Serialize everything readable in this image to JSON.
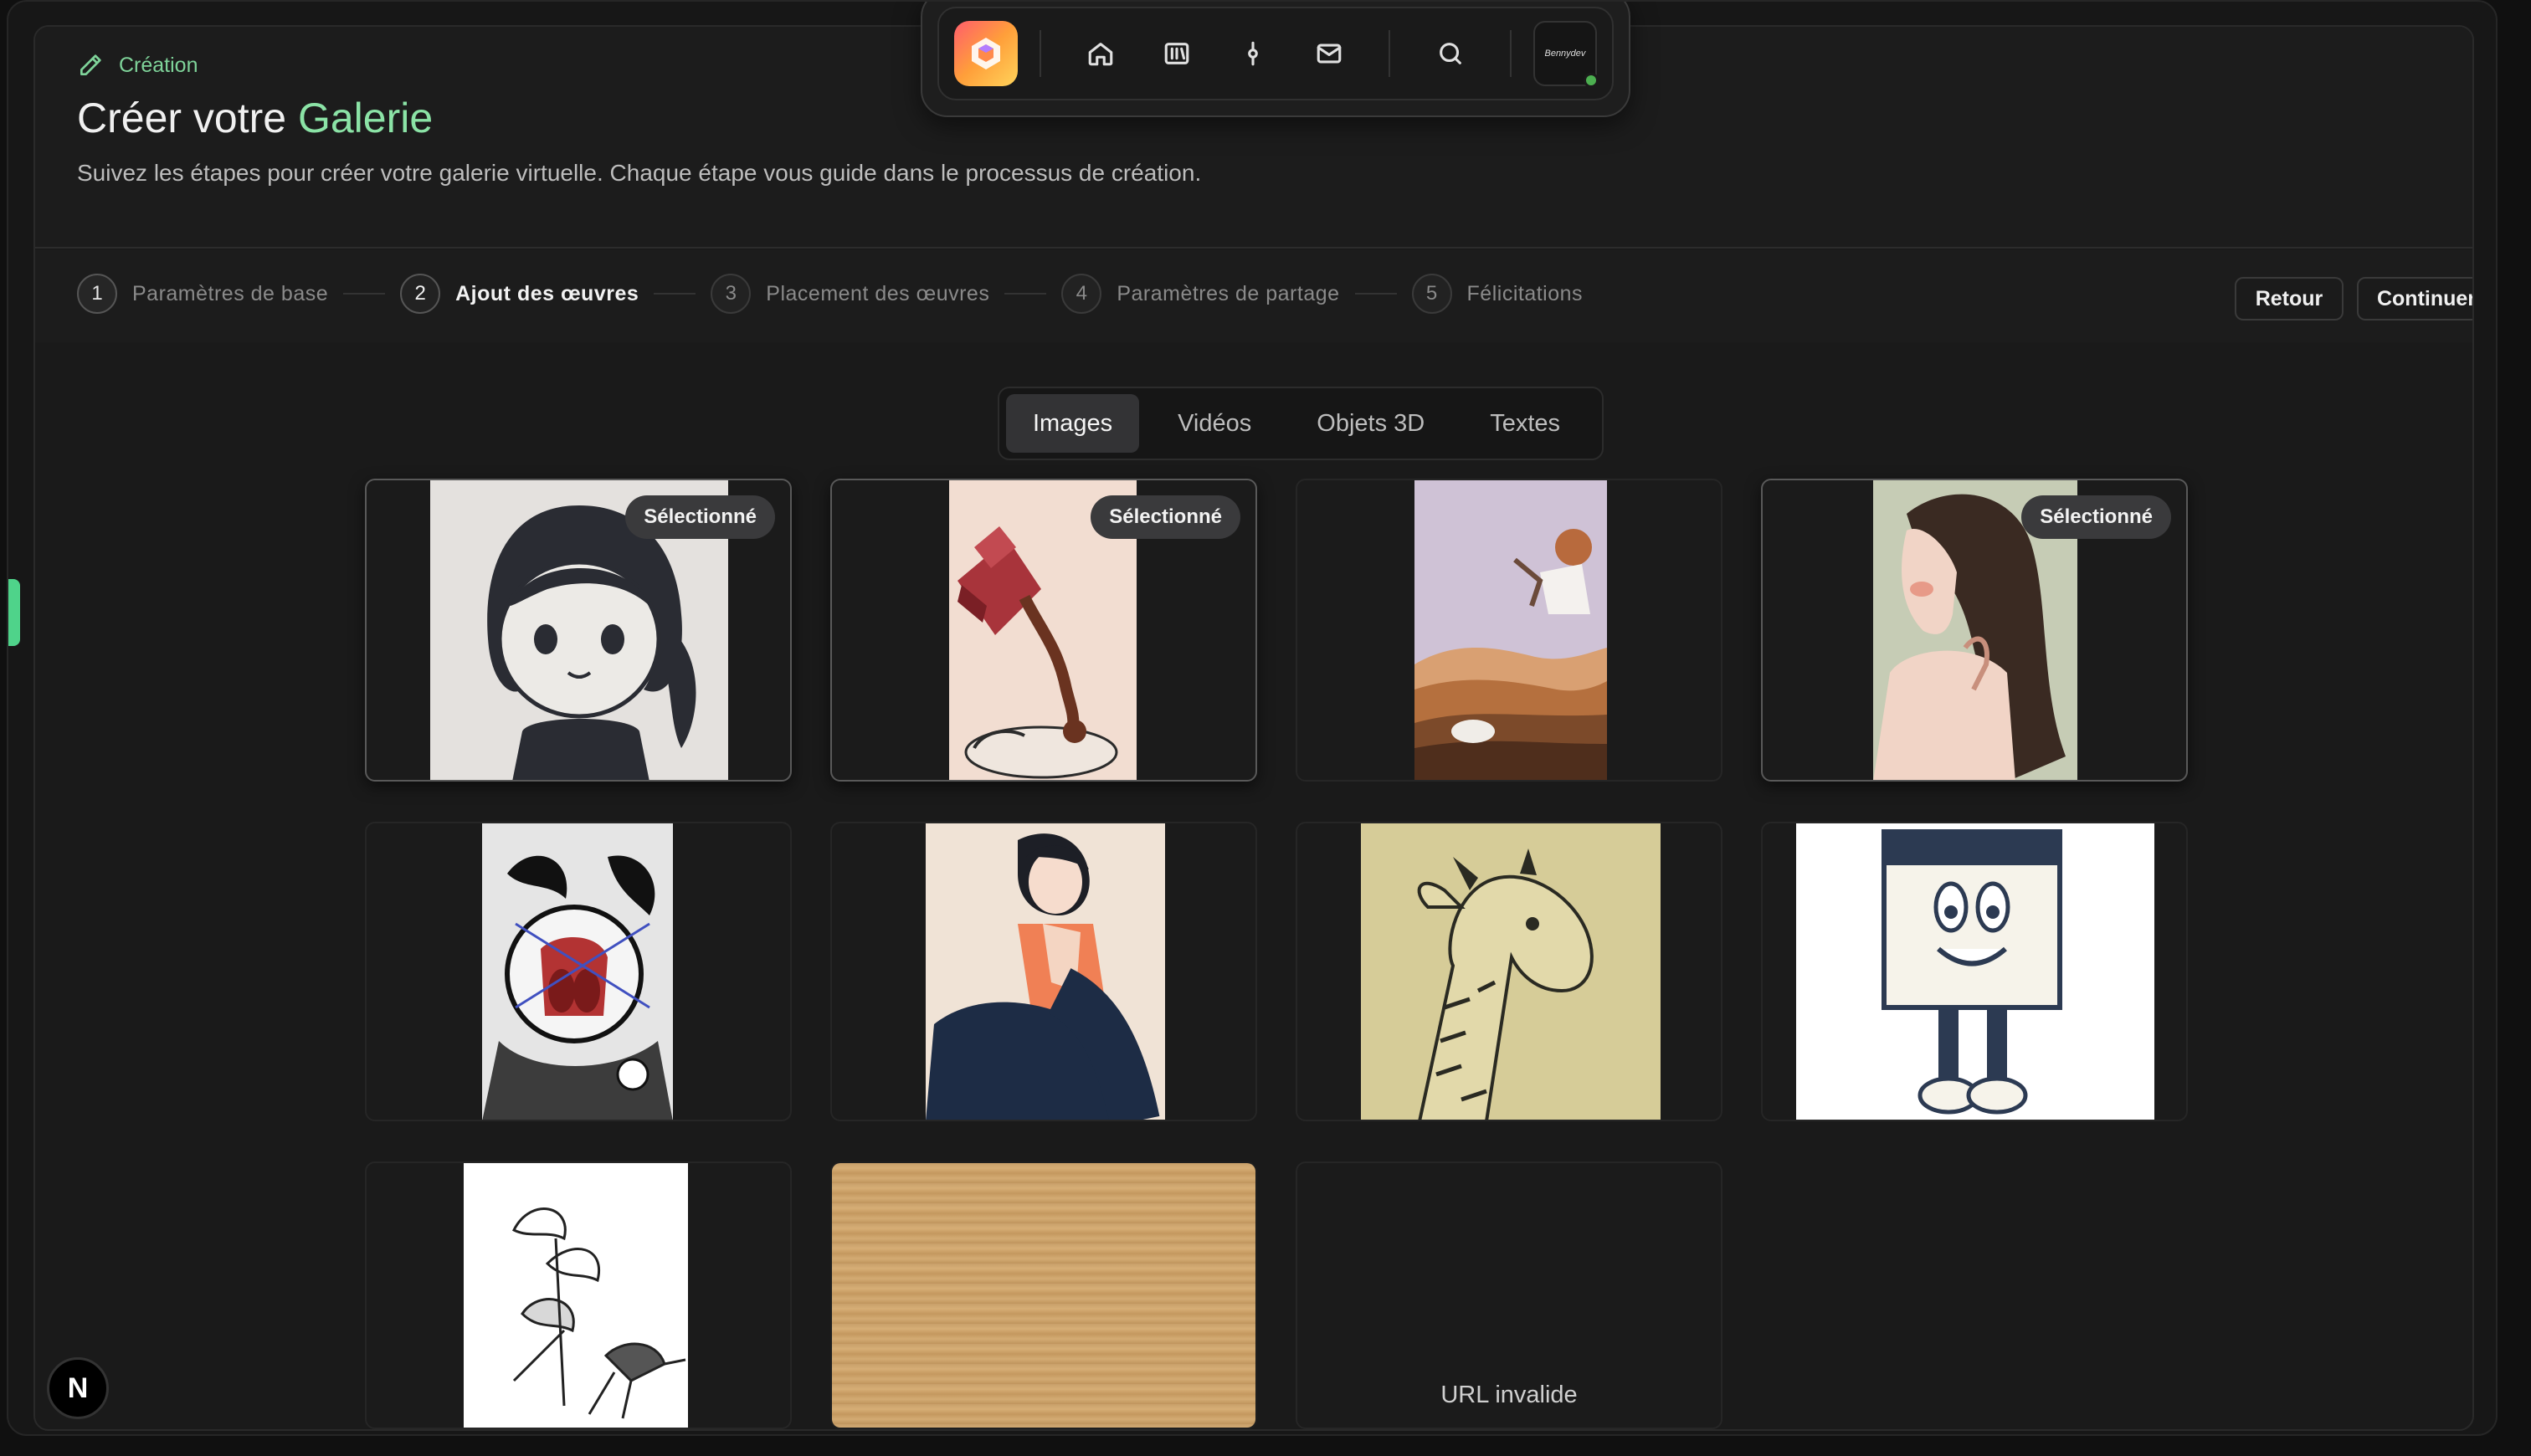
{
  "header": {
    "tag": "Création",
    "title_prefix": "Créer votre",
    "title_accent": "Galerie",
    "subtitle": "Suivez les étapes pour créer votre galerie virtuelle. Chaque étape vous guide dans le processus de création."
  },
  "steps": [
    {
      "num": "1",
      "label": "Paramètres de base"
    },
    {
      "num": "2",
      "label": "Ajout des œuvres"
    },
    {
      "num": "3",
      "label": "Placement des œuvres"
    },
    {
      "num": "4",
      "label": "Paramètres de partage"
    },
    {
      "num": "5",
      "label": "Félicitations"
    }
  ],
  "actions": {
    "back": "Retour",
    "next": "Continuer"
  },
  "tabs": [
    "Images",
    "Vidéos",
    "Objets 3D",
    "Textes"
  ],
  "gallery": {
    "selected_label": "Sélectionné",
    "invalid_label": "URL invalide"
  },
  "nav": {
    "avatar_text": "Bennydev"
  },
  "next_badge": "N",
  "colors": {
    "accent": "#8be3a6",
    "background": "#1a1a1a",
    "badge": "#3a3a3c"
  }
}
